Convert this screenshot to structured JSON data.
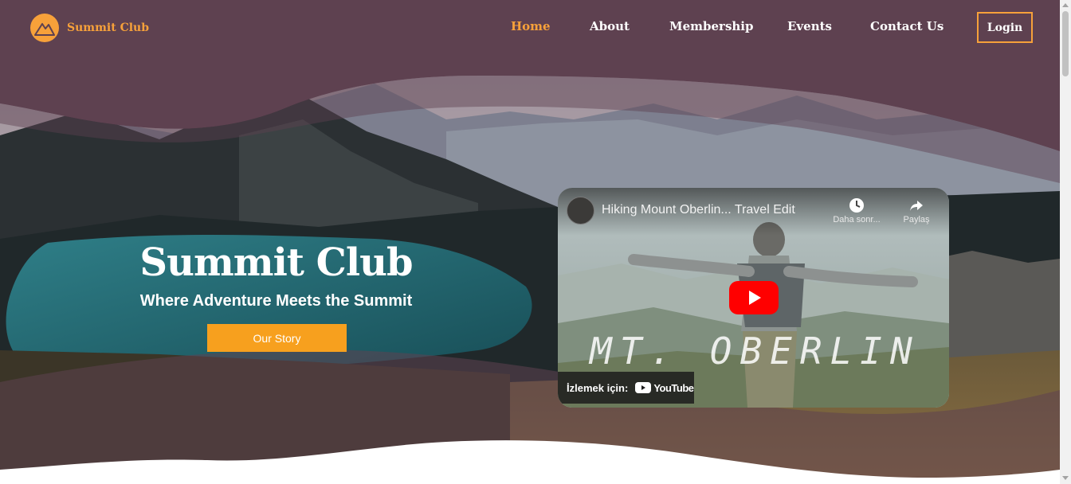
{
  "brand": {
    "name": "Summit Club",
    "logo_icon": "mountain-icon",
    "accent_color": "#f7a13a"
  },
  "nav": {
    "items": [
      {
        "label": "Home",
        "active": true
      },
      {
        "label": "About",
        "active": false
      },
      {
        "label": "Membership",
        "active": false
      },
      {
        "label": "Events",
        "active": false
      },
      {
        "label": "Contact Us",
        "active": false
      }
    ],
    "login_label": "Login"
  },
  "hero": {
    "title": "Summit Club",
    "subtitle": "Where Adventure Meets the Summit",
    "cta_label": "Our Story",
    "header_color": "#5e4150"
  },
  "video": {
    "title": "Hiking Mount Oberlin... Travel Edit",
    "watch_later_label": "Daha sonr...",
    "share_label": "Paylaş",
    "watch_on_label": "İzlemek için:",
    "platform": "YouTube",
    "overlay_text": "MT. OBERLIN",
    "play_icon": "play-icon"
  }
}
